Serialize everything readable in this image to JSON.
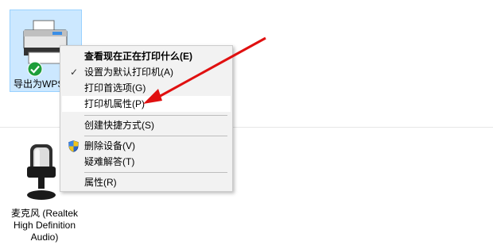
{
  "devices": {
    "printer": {
      "label": "导出为WPS",
      "icon": "printer-icon",
      "status_icon": "green-check-icon"
    },
    "microphone": {
      "label_lines": [
        "麦克风 (Realtek",
        "High Definition",
        "Audio)"
      ],
      "icon": "microphone-icon"
    }
  },
  "context_menu": {
    "items": [
      {
        "label": "查看现在正在打印什么(E)"
      },
      {
        "label": "设置为默认打印机(A)"
      },
      {
        "label": "打印首选项(G)"
      },
      {
        "label": "打印机属性(P)"
      },
      {
        "label": "创建快捷方式(S)"
      },
      {
        "label": "删除设备(V)"
      },
      {
        "label": "疑难解答(T)"
      },
      {
        "label": "属性(R)"
      }
    ],
    "check_glyph": "✓"
  },
  "colors": {
    "selection_bg": "#cce8ff",
    "selection_border": "#99d1ff",
    "menu_bg": "#f2f2f2",
    "annotation_arrow": "#e01010"
  }
}
